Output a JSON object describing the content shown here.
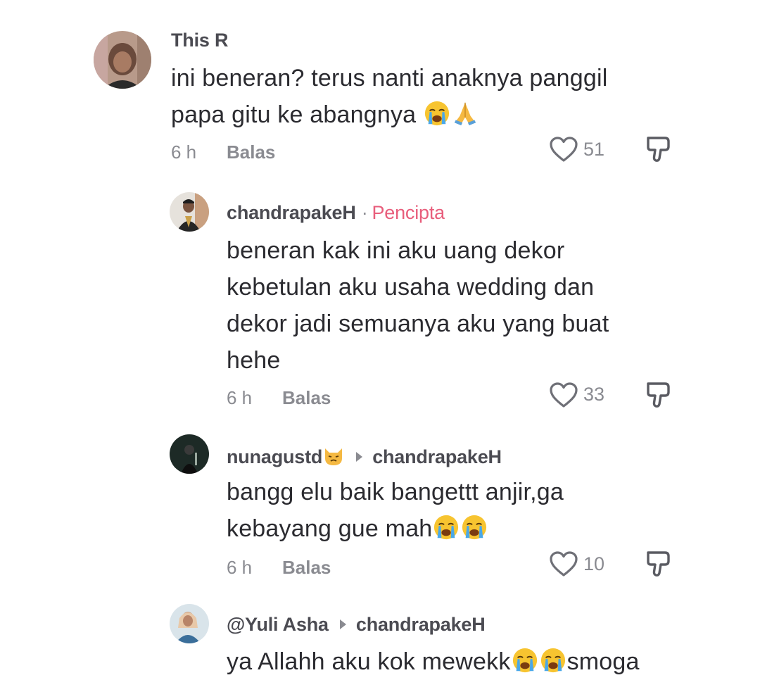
{
  "comments": [
    {
      "username": "This R",
      "lines": [
        "ini beneran? terus nanti anaknya panggil",
        "papa gitu ke abangnya"
      ],
      "emoji_names": [
        "loudly-crying-face",
        "folded-hands"
      ],
      "time": "6 h",
      "reply_label": "Balas",
      "likes": "51"
    },
    {
      "username": "chandrapakeH",
      "creator_separator": "·",
      "creator_tag": "Pencipta",
      "lines": [
        "beneran kak ini aku uang dekor",
        "kebetulan aku usaha wedding dan",
        "dekor jadi semuanya aku yang buat",
        "hehe"
      ],
      "time": "6 h",
      "reply_label": "Balas",
      "likes": "33"
    },
    {
      "username": "nunagustd",
      "username_emoji": "cat-face",
      "reply_to": "chandrapakeH",
      "lines": [
        "bangg elu baik bangettt anjir,ga",
        "kebayang gue mah"
      ],
      "emoji_names": [
        "loudly-crying-face",
        "loudly-crying-face"
      ],
      "time": "6 h",
      "reply_label": "Balas",
      "likes": "10"
    },
    {
      "username": "@Yuli Asha",
      "reply_to": "chandrapakeH",
      "lines": [
        "ya Allahh aku kok mewekk",
        "smoga"
      ],
      "emoji_names": [
        "loudly-crying-face",
        "loudly-crying-face"
      ]
    }
  ],
  "colors": {
    "username": "#4b4b52",
    "creator_tag": "#e85e7c",
    "meta": "#8a8b91",
    "text": "#2b2b30"
  },
  "icons": [
    "heart-outline-icon",
    "thumbs-down-icon"
  ]
}
